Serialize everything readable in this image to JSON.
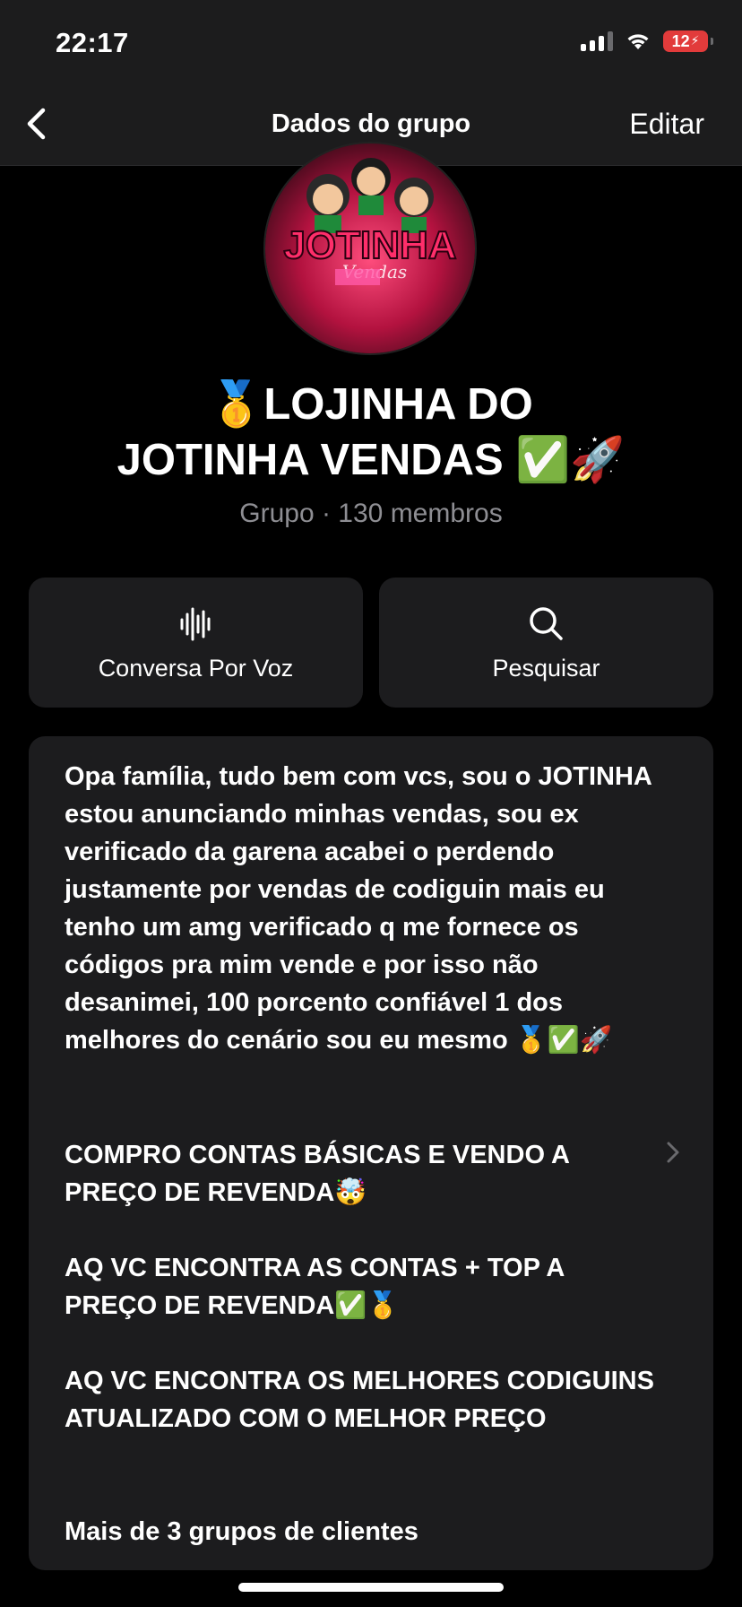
{
  "status": {
    "time": "22:17",
    "battery": "12"
  },
  "nav": {
    "title": "Dados do grupo",
    "edit": "Editar"
  },
  "group": {
    "name_line1": "🥇LOJINHA DO",
    "name_line2": "JOTINHA VENDAS ✅🚀",
    "subtitle": "Grupo · 130 membros"
  },
  "actions": {
    "voice": "Conversa Por Voz",
    "search": "Pesquisar"
  },
  "description": {
    "p1": "Opa família, tudo bem com vcs, sou o JOTINHA estou anunciando minhas vendas, sou ex verificado da garena acabei o perdendo justamente por vendas de codiguin mais eu tenho um amg verificado q me fornece os códigos pra mim vende e por isso não desanimei, 100 porcento confiável 1 dos melhores do cenário sou eu mesmo 🥇✅🚀",
    "p2": "COMPRO CONTAS BÁSICAS E VENDO A PREÇO DE REVENDA🤯",
    "p3": "AQ VC ENCONTRA AS CONTAS + TOP A PREÇO DE REVENDA✅🥇",
    "p4": "AQ VC ENCONTRA OS MELHORES CODIGUINS ATUALIZADO COM O MELHOR PREÇO",
    "p5": "Mais de 3 grupos de clientes"
  },
  "avatar_text": {
    "logo_main": "JOTINHA",
    "logo_script": "Vendas"
  },
  "icons": [
    "back-chevron-icon",
    "cellular-signal-icon",
    "wifi-icon",
    "battery-icon",
    "sound-wave-icon",
    "search-icon",
    "chevron-right-icon"
  ]
}
